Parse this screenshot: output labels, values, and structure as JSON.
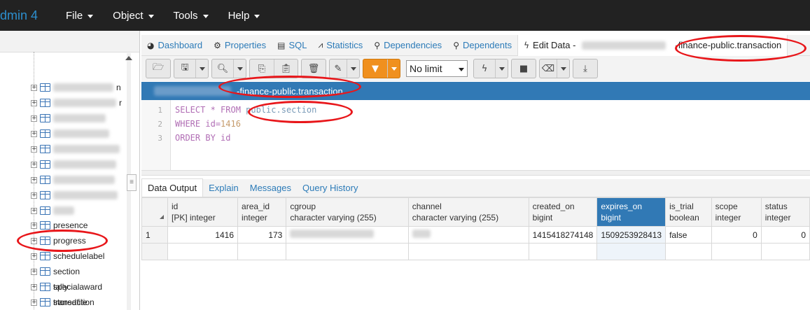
{
  "app": {
    "brand": "dmin 4"
  },
  "menu": [
    {
      "label": "File"
    },
    {
      "label": "Object"
    },
    {
      "label": "Tools"
    },
    {
      "label": "Help"
    }
  ],
  "tree": {
    "items": [
      {
        "label": "presence"
      },
      {
        "label": "progress"
      },
      {
        "label": "schedulelabel"
      },
      {
        "label": "section"
      },
      {
        "label": "specialaward"
      },
      {
        "label": "storedfile"
      },
      {
        "label": "tally"
      },
      {
        "label": "transaction"
      }
    ],
    "blurred_partial": [
      "n",
      "r"
    ]
  },
  "tabs": [
    {
      "label": "Dashboard",
      "icon": "dashboard-icon"
    },
    {
      "label": "Properties",
      "icon": "gear-icon"
    },
    {
      "label": "SQL",
      "icon": "file-text-icon"
    },
    {
      "label": "Statistics",
      "icon": "chart-icon"
    },
    {
      "label": "Dependencies",
      "icon": "dependencies-icon"
    },
    {
      "label": "Dependents",
      "icon": "dependents-icon"
    },
    {
      "label": "Edit Data -",
      "icon": "lightning-icon",
      "suffix": "-finance-public.transaction"
    }
  ],
  "toolbar": {
    "limit": "No limit"
  },
  "connection": {
    "label": "-finance-public.transaction"
  },
  "editor": {
    "lines": [
      {
        "n": "1"
      },
      {
        "n": "2"
      },
      {
        "n": "3"
      }
    ],
    "line1_kw": "SELECT * FROM ",
    "line1_id": "public.section",
    "line2_kw": "WHERE ",
    "line2_id": "id",
    "line2_op": "=",
    "line2_num": "1416",
    "line3_kw": "ORDER BY ",
    "line3_id": "id"
  },
  "output_tabs": [
    {
      "label": "Data Output"
    },
    {
      "label": "Explain"
    },
    {
      "label": "Messages"
    },
    {
      "label": "Query History"
    }
  ],
  "grid": {
    "columns": [
      {
        "name": "id",
        "type": "[PK] integer"
      },
      {
        "name": "area_id",
        "type": "integer"
      },
      {
        "name": "cgroup",
        "type": "character varying (255)"
      },
      {
        "name": "channel",
        "type": "character varying (255)"
      },
      {
        "name": "created_on",
        "type": "bigint"
      },
      {
        "name": "expires_on",
        "type": "bigint"
      },
      {
        "name": "is_trial",
        "type": "boolean"
      },
      {
        "name": "scope",
        "type": "integer"
      },
      {
        "name": "status",
        "type": "integer"
      }
    ],
    "rows": [
      {
        "rownum": "1",
        "id": "1416",
        "area_id": "173",
        "cgroup": "",
        "channel": "",
        "created_on": "1415418274148",
        "expires_on": "1509253928413",
        "is_trial": "false",
        "scope": "0",
        "status": "0"
      }
    ]
  },
  "colors": {
    "nav_bg": "#222222",
    "brand": "#2c8fcf",
    "accent": "#3179b5",
    "annotation": "#e8161a",
    "filter": "#f0901e"
  }
}
